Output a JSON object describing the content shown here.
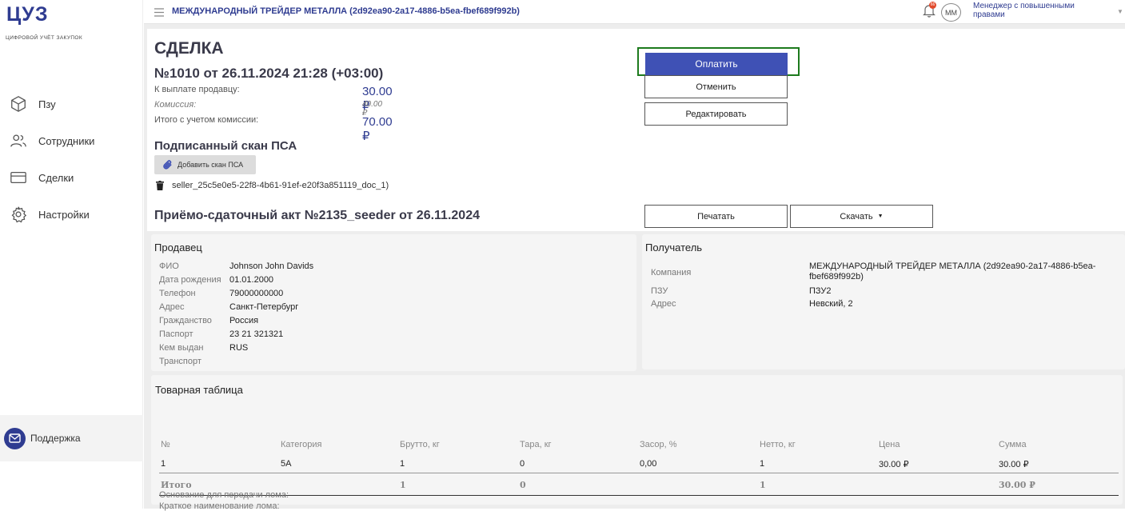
{
  "app": {
    "logo": "ЦУЗ",
    "logo_subtitle": "ЦИФРОВОЙ УЧЁТ ЗАКУПОК"
  },
  "sidebar": {
    "items": [
      {
        "label": "Пзу",
        "icon": "cube-icon"
      },
      {
        "label": "Сотрудники",
        "icon": "users-icon"
      },
      {
        "label": "Сделки",
        "icon": "card-icon"
      },
      {
        "label": "Настройки",
        "icon": "gear-icon"
      }
    ],
    "support_label": "Поддержка"
  },
  "topbar": {
    "title": "МЕЖДУНАРОДНЫЙ ТРЕЙДЕР МЕТАЛЛА (2d92ea90-2a17-4886-b5ea-fbef689f992b)",
    "notification_count": "66",
    "avatar_initials": "ММ",
    "user_role": "Менеджер с повышенными правами"
  },
  "deal": {
    "heading": "СДЕЛКА",
    "number": "№1010 от 26.11.2024 21:28 (+03:00)",
    "payout_label": "К выплате продавцу:",
    "payout_value": "30.00 ₽",
    "commission_label": "Комиссия:",
    "commission_value": "40.00 ₽",
    "total_label": "Итого с учетом комиссии:",
    "total_value": "70.00 ₽"
  },
  "actions": {
    "pay": "Оплатить",
    "cancel": "Отменить",
    "edit": "Редактировать"
  },
  "scan": {
    "heading": "Подписанный скан ПСА",
    "add_button": "Добавить скан ПСА",
    "file_name": "seller_25c5e0e5-22f8-4b61-91ef-e20f3a851119_doc_1)"
  },
  "act": {
    "heading": "Приёмо-сдаточный акт №2135_seeder от 26.11.2024",
    "print": "Печатать",
    "download": "Скачать"
  },
  "seller": {
    "title": "Продавец",
    "fields": [
      {
        "k": "ФИО",
        "v": "Johnson John Davids"
      },
      {
        "k": "Дата рождения",
        "v": "01.01.2000"
      },
      {
        "k": "Телефон",
        "v": "79000000000"
      },
      {
        "k": "Адрес",
        "v": "Санкт-Петербург"
      },
      {
        "k": "Гражданство",
        "v": "Россия"
      },
      {
        "k": "Паспорт",
        "v": "23 21 321321"
      },
      {
        "k": "Кем выдан",
        "v": "RUS"
      },
      {
        "k": "Транспорт",
        "v": ""
      }
    ]
  },
  "receiver": {
    "title": "Получатель",
    "company_label": "Компания",
    "company_value": "МЕЖДУНАРОДНЫЙ ТРЕЙДЕР МЕТАЛЛА (2d92ea90-2a17-4886-b5ea-fbef689f992b)",
    "pzu_label": "ПЗУ",
    "pzu_value": "ПЗУ2",
    "address_label": "Адрес",
    "address_value": "Невский, 2"
  },
  "goods": {
    "title": "Товарная таблица",
    "columns": [
      "№",
      "Категория",
      "Брутто, кг",
      "Тара, кг",
      "Засор, %",
      "Нетто, кг",
      "Цена",
      "Сумма"
    ],
    "rows": [
      [
        "1",
        "5А",
        "1",
        "0",
        "0,00",
        "1",
        "30.00 ₽",
        "30.00 ₽"
      ]
    ],
    "total": [
      "Итого",
      "",
      "1",
      "0",
      "",
      "1",
      "",
      "30.00 ₽"
    ],
    "short_name_label": "Краткое наименование лома:",
    "basis_label": "Основание для передачи лома:"
  }
}
